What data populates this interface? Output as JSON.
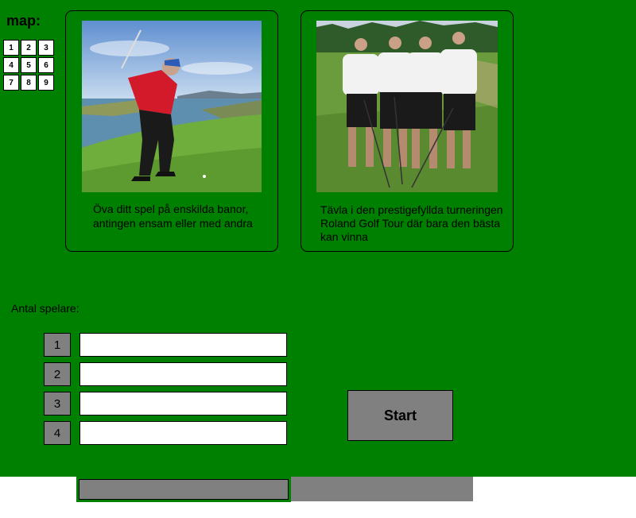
{
  "colors": {
    "background": "#008000",
    "button": "#808080"
  },
  "map": {
    "title": "map:",
    "cells": [
      "1",
      "2",
      "3",
      "4",
      "5",
      "6",
      "7",
      "8",
      "9"
    ]
  },
  "cards": [
    {
      "text": "Öva ditt spel på enskilda banor, antingen ensam eller med andra",
      "image": "golfer-swing-photo"
    },
    {
      "text": "Tävla i den prestigefyllda turneringen Roland Golf Tour där bara den bästa kan vinna",
      "image": "four-golfers-photo"
    }
  ],
  "players": {
    "label": "Antal spelare:",
    "rows": [
      {
        "number": "1",
        "value": ""
      },
      {
        "number": "2",
        "value": ""
      },
      {
        "number": "3",
        "value": ""
      },
      {
        "number": "4",
        "value": ""
      }
    ]
  },
  "start_label": "Start"
}
